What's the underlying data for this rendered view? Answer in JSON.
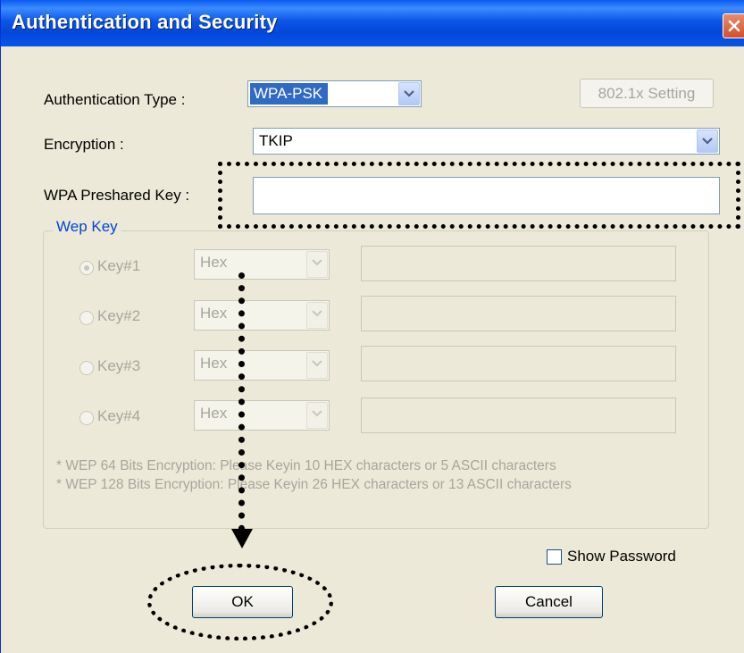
{
  "window": {
    "title": "Authentication and Security",
    "close_icon": "close-icon"
  },
  "auth": {
    "label": "Authentication Type :",
    "value": "WPA-PSK",
    "setting_button": "802.1x Setting"
  },
  "encryption": {
    "label": "Encryption :",
    "value": "TKIP"
  },
  "psk": {
    "label": "WPA Preshared Key :",
    "value": ""
  },
  "wep": {
    "legend": "Wep Key",
    "keys": [
      {
        "label": "Key#1",
        "format": "Hex",
        "selected": true
      },
      {
        "label": "Key#2",
        "format": "Hex",
        "selected": false
      },
      {
        "label": "Key#3",
        "format": "Hex",
        "selected": false
      },
      {
        "label": "Key#4",
        "format": "Hex",
        "selected": false
      }
    ],
    "note1": "* WEP 64 Bits Encryption:  Please Keyin 10 HEX characters or 5 ASCII characters",
    "note2": "* WEP 128 Bits Encryption:  Please Keyin 26 HEX characters or 13 ASCII characters"
  },
  "show_password": {
    "label": "Show Password",
    "checked": false
  },
  "buttons": {
    "ok": "OK",
    "cancel": "Cancel"
  }
}
